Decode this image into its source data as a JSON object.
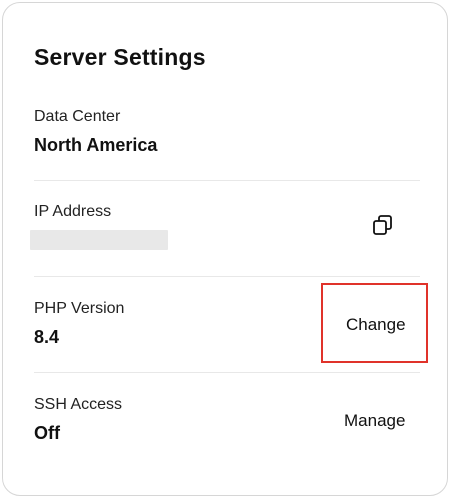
{
  "card": {
    "title": "Server Settings"
  },
  "data_center": {
    "label": "Data Center",
    "value": "North America"
  },
  "ip_address": {
    "label": "IP Address",
    "value_redacted": true,
    "copy_icon": "copy-icon"
  },
  "php_version": {
    "label": "PHP Version",
    "value": "8.4",
    "action_label": "Change"
  },
  "ssh_access": {
    "label": "SSH Access",
    "value": "Off",
    "action_label": "Manage"
  },
  "colors": {
    "highlight": "#e0322a",
    "redaction": "#e8e8e8",
    "divider": "#e8e8e8"
  }
}
